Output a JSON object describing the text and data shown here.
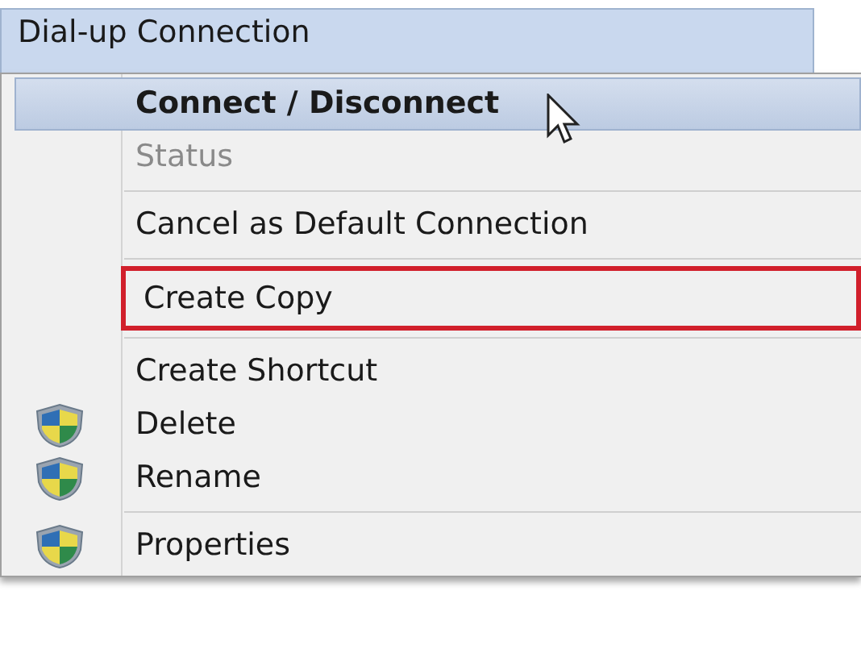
{
  "connection": {
    "name": "Dial-up Connection",
    "selected": true
  },
  "context_menu": [
    {
      "kind": "item",
      "label": "Connect / Disconnect",
      "default": true,
      "disabled": false,
      "selected": true,
      "shield": false,
      "outlined": false
    },
    {
      "kind": "item",
      "label": "Status",
      "default": false,
      "disabled": true,
      "selected": false,
      "shield": false,
      "outlined": false
    },
    {
      "kind": "separator"
    },
    {
      "kind": "item",
      "label": "Cancel as Default Connection",
      "default": false,
      "disabled": false,
      "selected": false,
      "shield": false,
      "outlined": false
    },
    {
      "kind": "separator"
    },
    {
      "kind": "item",
      "label": "Create Copy",
      "default": false,
      "disabled": false,
      "selected": false,
      "shield": false,
      "outlined": true
    },
    {
      "kind": "separator"
    },
    {
      "kind": "item",
      "label": "Create Shortcut",
      "default": false,
      "disabled": false,
      "selected": false,
      "shield": false,
      "outlined": false
    },
    {
      "kind": "item",
      "label": "Delete",
      "default": false,
      "disabled": false,
      "selected": false,
      "shield": true,
      "outlined": false
    },
    {
      "kind": "item",
      "label": "Rename",
      "default": false,
      "disabled": false,
      "selected": false,
      "shield": true,
      "outlined": false
    },
    {
      "kind": "separator"
    },
    {
      "kind": "item",
      "label": "Properties",
      "default": false,
      "disabled": false,
      "selected": false,
      "shield": true,
      "outlined": false
    }
  ]
}
